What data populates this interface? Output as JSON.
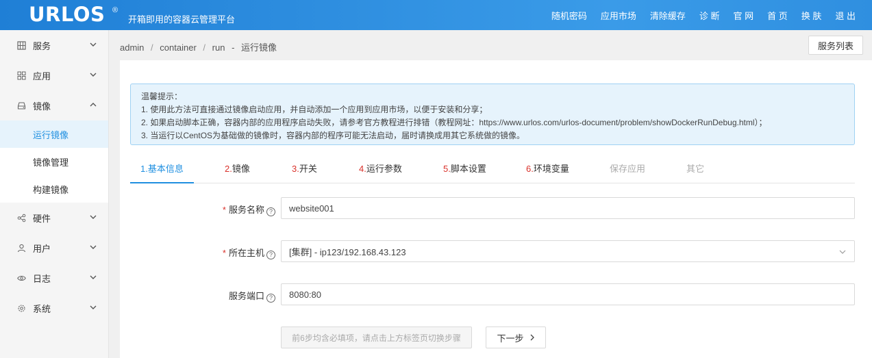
{
  "header": {
    "logo": "URLOS",
    "registered": "®",
    "slogan": "开箱即用的容器云管理平台",
    "nav": [
      "随机密码",
      "应用市场",
      "清除缓存",
      "诊 断",
      "官 网",
      "首 页",
      "换 肤",
      "退 出"
    ]
  },
  "sidebar": {
    "items": [
      {
        "label": "服务",
        "icon": "grid-icon",
        "expanded": false
      },
      {
        "label": "应用",
        "icon": "apps-icon",
        "expanded": false
      },
      {
        "label": "镜像",
        "icon": "disk-icon",
        "expanded": true
      },
      {
        "label": "硬件",
        "icon": "share-icon",
        "expanded": false
      },
      {
        "label": "用户",
        "icon": "user-icon",
        "expanded": false
      },
      {
        "label": "日志",
        "icon": "eye-icon",
        "expanded": false
      },
      {
        "label": "系统",
        "icon": "gear-icon",
        "expanded": false
      }
    ],
    "subitems": [
      "运行镜像",
      "镜像管理",
      "构建镜像"
    ],
    "active_sub": "运行镜像"
  },
  "breadcrumb": {
    "parts": [
      "admin",
      "container",
      "run"
    ],
    "separator": "/",
    "dash": "-",
    "current": "运行镜像"
  },
  "list_button": "服务列表",
  "tip": {
    "title": "温馨提示：",
    "lines": [
      "1. 使用此方法可直接通过镜像启动应用，并自动添加一个应用到应用市场，以便于安装和分享；",
      "2. 如果启动脚本正确，容器内部的应用程序启动失败，请参考官方教程进行排错（教程网址：https://www.urlos.com/urlos-document/problem/showDockerRunDebug.html）；",
      "3. 当运行以CentOS为基础做的镜像时，容器内部的程序可能无法启动，届时请换成用其它系统做的镜像。"
    ]
  },
  "tabs": [
    {
      "num": "1.",
      "label": "基本信息",
      "state": "active"
    },
    {
      "num": "2.",
      "label": "镜像",
      "state": "normal"
    },
    {
      "num": "3.",
      "label": "开关",
      "state": "normal"
    },
    {
      "num": "4.",
      "label": "运行参数",
      "state": "normal"
    },
    {
      "num": "5.",
      "label": "脚本设置",
      "state": "normal"
    },
    {
      "num": "6.",
      "label": "环境变量",
      "state": "normal"
    },
    {
      "num": "",
      "label": "保存应用",
      "state": "muted"
    },
    {
      "num": "",
      "label": "其它",
      "state": "muted"
    }
  ],
  "form": {
    "service_name": {
      "label": "服务名称",
      "required": "*",
      "value": "website001"
    },
    "host": {
      "label": "所在主机",
      "required": "*",
      "value": "[集群] - ip123/192.168.43.123"
    },
    "port": {
      "label": "服务端口",
      "value": "8080:80"
    },
    "help_glyph": "?"
  },
  "buttons": {
    "disabled_hint": "前6步均含必填项，请点击上方标签页切换步骤",
    "next": "下一步"
  },
  "colors": {
    "header": "#2f8fe0",
    "accent": "#1f8fe0",
    "required": "#d9312a",
    "tip_bg": "#e6f3fc"
  }
}
